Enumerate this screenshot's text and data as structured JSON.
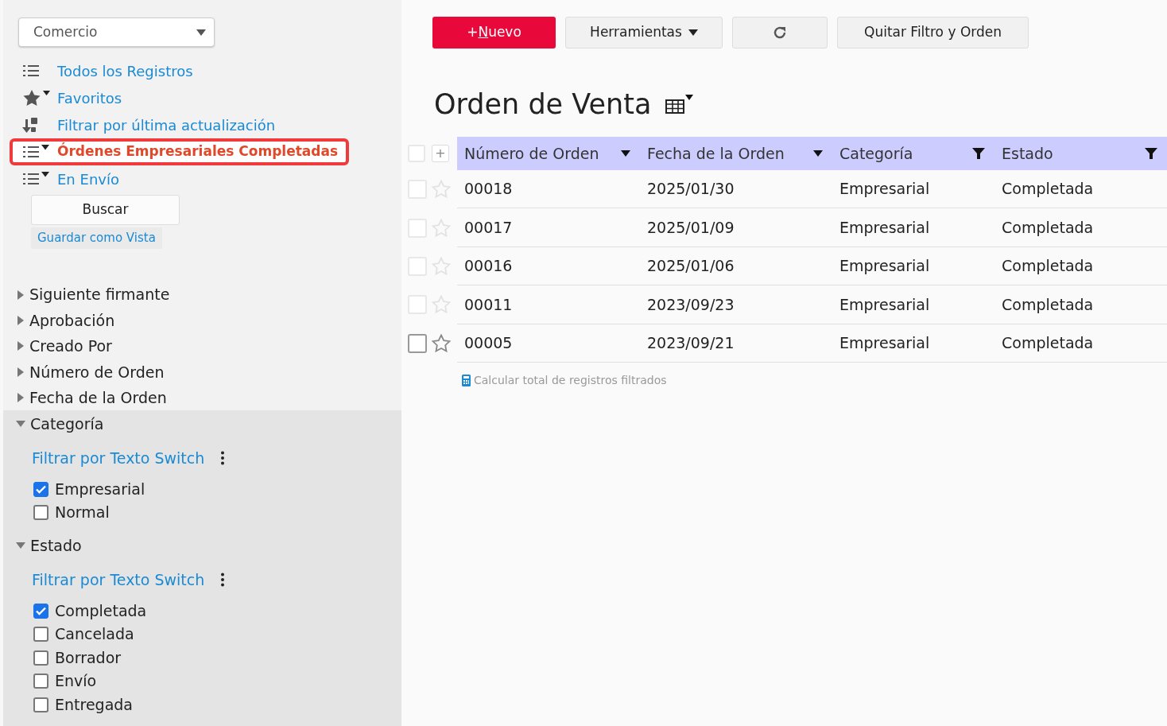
{
  "sidebar": {
    "app_selector": {
      "value": "Comercio"
    },
    "views": [
      {
        "label": "Todos los Registros",
        "kind": "list",
        "selected": false
      },
      {
        "label": "Favoritos",
        "kind": "star",
        "selected": false
      },
      {
        "label": "Filtrar por última actualización",
        "kind": "sort",
        "selected": false
      },
      {
        "label": "Órdenes Empresariales Completadas",
        "kind": "filter",
        "selected": true
      },
      {
        "label": "En Envío",
        "kind": "filter",
        "selected": false
      }
    ],
    "search_button": "Buscar",
    "save_view_link": "Guardar como Vista",
    "filters": [
      {
        "label": "Siguiente firmante",
        "expanded": false
      },
      {
        "label": "Aprobación",
        "expanded": false
      },
      {
        "label": "Creado Por",
        "expanded": false
      },
      {
        "label": "Número de Orden",
        "expanded": false
      },
      {
        "label": "Fecha de la Orden",
        "expanded": false
      },
      {
        "label": "Categoría",
        "expanded": true,
        "switch_link": "Filtrar por Texto Switch",
        "options": [
          {
            "label": "Empresarial",
            "checked": true
          },
          {
            "label": "Normal",
            "checked": false
          }
        ]
      },
      {
        "label": "Estado",
        "expanded": true,
        "switch_link": "Filtrar por Texto Switch",
        "options": [
          {
            "label": "Completada",
            "checked": true
          },
          {
            "label": "Cancelada",
            "checked": false
          },
          {
            "label": "Borrador",
            "checked": false
          },
          {
            "label": "Envío",
            "checked": false
          },
          {
            "label": "Entregada",
            "checked": false
          }
        ]
      }
    ]
  },
  "toolbar": {
    "new_button": {
      "before": "+",
      "key": "N",
      "after": "uevo"
    },
    "tools_button": "Herramientas",
    "clear_button": "Quitar Filtro y Orden"
  },
  "title": "Orden de Venta",
  "table": {
    "select_all": {
      "checked": false
    },
    "add_column": "+",
    "columns": [
      {
        "label": "Número de Orden",
        "filtered": false
      },
      {
        "label": "Fecha de la Orden",
        "filtered": false
      },
      {
        "label": "Categoría",
        "filtered": true
      },
      {
        "label": "Estado",
        "filtered": true
      }
    ],
    "rows": [
      {
        "cells": [
          "00018",
          "2025/01/30",
          "Empresarial",
          "Completada"
        ],
        "hovered": false
      },
      {
        "cells": [
          "00017",
          "2025/01/09",
          "Empresarial",
          "Completada"
        ],
        "hovered": false
      },
      {
        "cells": [
          "00016",
          "2025/01/06",
          "Empresarial",
          "Completada"
        ],
        "hovered": false
      },
      {
        "cells": [
          "00011",
          "2023/09/23",
          "Empresarial",
          "Completada"
        ],
        "hovered": false
      },
      {
        "cells": [
          "00005",
          "2023/09/21",
          "Empresarial",
          "Completada"
        ],
        "hovered": true
      }
    ]
  },
  "total_link": "Calcular total de registros filtrados"
}
